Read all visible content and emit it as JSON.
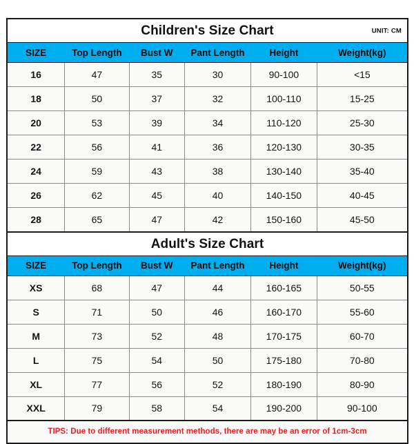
{
  "document": {
    "unit_label": "UNIT: CM",
    "accent_color": "#00aeef",
    "tips_color": "#ee1c25",
    "border_color": "#1a1a1a"
  },
  "children_chart": {
    "title": "Children's Size Chart",
    "unit": "UNIT: CM",
    "columns": [
      "SIZE",
      "Top Length",
      "Bust W",
      "Pant Length",
      "Height",
      "Weight(kg)"
    ],
    "rows": [
      [
        "16",
        "47",
        "35",
        "30",
        "90-100",
        "<15"
      ],
      [
        "18",
        "50",
        "37",
        "32",
        "100-110",
        "15-25"
      ],
      [
        "20",
        "53",
        "39",
        "34",
        "110-120",
        "25-30"
      ],
      [
        "22",
        "56",
        "41",
        "36",
        "120-130",
        "30-35"
      ],
      [
        "24",
        "59",
        "43",
        "38",
        "130-140",
        "35-40"
      ],
      [
        "26",
        "62",
        "45",
        "40",
        "140-150",
        "40-45"
      ],
      [
        "28",
        "65",
        "47",
        "42",
        "150-160",
        "45-50"
      ]
    ]
  },
  "adult_chart": {
    "title": "Adult's Size Chart",
    "columns": [
      "SIZE",
      "Top Length",
      "Bust W",
      "Pant Length",
      "Height",
      "Weight(kg)"
    ],
    "rows": [
      [
        "XS",
        "68",
        "47",
        "44",
        "160-165",
        "50-55"
      ],
      [
        "S",
        "71",
        "50",
        "46",
        "160-170",
        "55-60"
      ],
      [
        "M",
        "73",
        "52",
        "48",
        "170-175",
        "60-70"
      ],
      [
        "L",
        "75",
        "54",
        "50",
        "175-180",
        "70-80"
      ],
      [
        "XL",
        "77",
        "56",
        "52",
        "180-190",
        "80-90"
      ],
      [
        "XXL",
        "79",
        "58",
        "54",
        "190-200",
        "90-100"
      ]
    ]
  },
  "tips": {
    "text": "TIPS: Due to different measurement methods, there are may be an error of 1cm-3cm"
  }
}
